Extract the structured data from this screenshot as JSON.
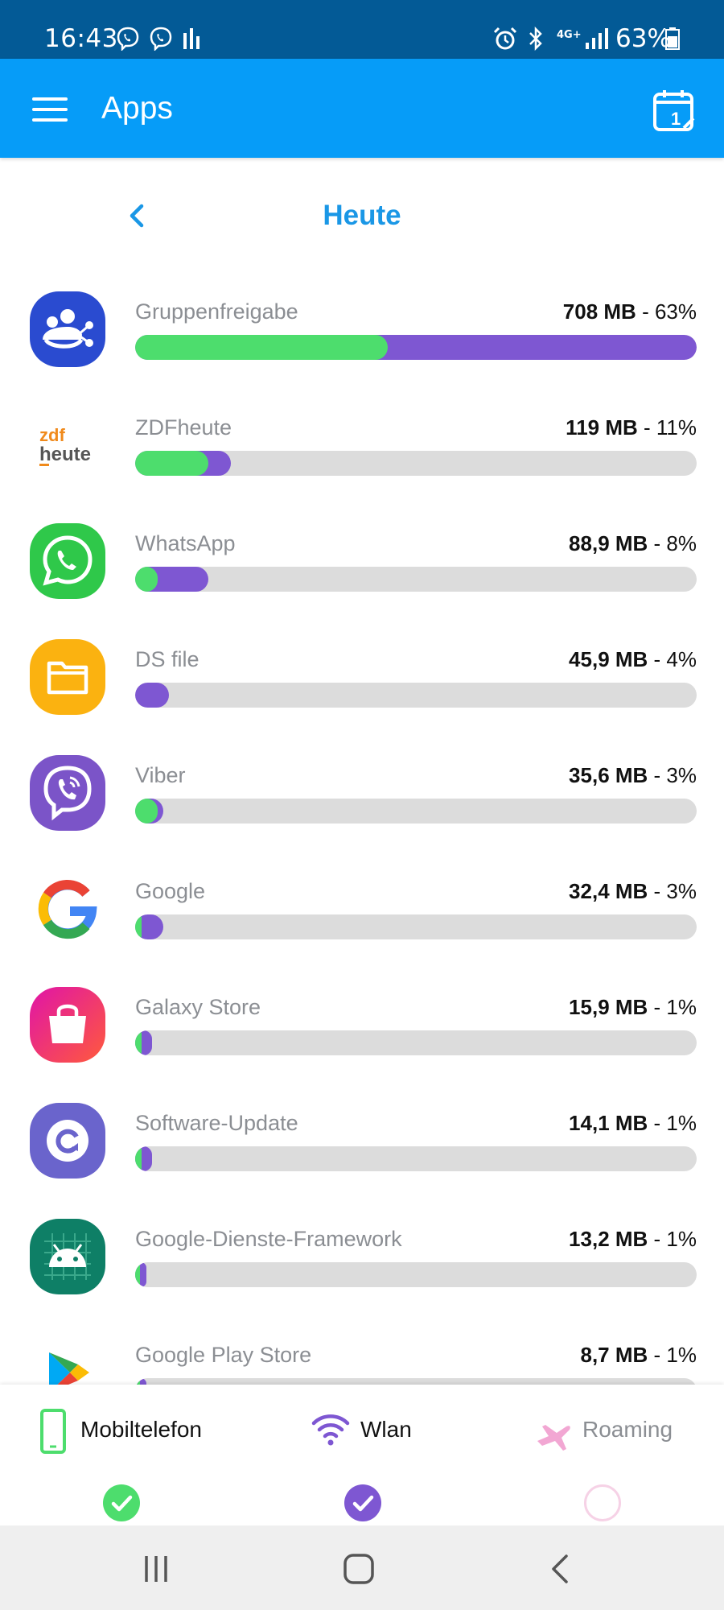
{
  "status_bar": {
    "time": "16:43",
    "battery": "63%",
    "network": "4G+"
  },
  "app_bar": {
    "title": "Apps",
    "calendar_day": "1"
  },
  "period": {
    "title": "Heute"
  },
  "apps": [
    {
      "name": "Gruppenfreigabe",
      "size": "708 MB",
      "percent": "63%",
      "fill_total": 1.0,
      "fill_mobile": 0.45
    },
    {
      "name": "ZDFheute",
      "size": "119 MB",
      "percent": "11%",
      "fill_total": 0.17,
      "fill_mobile": 0.13
    },
    {
      "name": "WhatsApp",
      "size": "88,9 MB",
      "percent": "8%",
      "fill_total": 0.13,
      "fill_mobile": 0.04
    },
    {
      "name": "DS file",
      "size": "45,9 MB",
      "percent": "4%",
      "fill_total": 0.06,
      "fill_mobile": 0.0
    },
    {
      "name": "Viber",
      "size": "35,6 MB",
      "percent": "3%",
      "fill_total": 0.05,
      "fill_mobile": 0.04
    },
    {
      "name": "Google",
      "size": "32,4 MB",
      "percent": "3%",
      "fill_total": 0.05,
      "fill_mobile": 0.012
    },
    {
      "name": "Galaxy Store",
      "size": "15,9 MB",
      "percent": "1%",
      "fill_total": 0.03,
      "fill_mobile": 0.012
    },
    {
      "name": "Software-Update",
      "size": "14,1 MB",
      "percent": "1%",
      "fill_total": 0.03,
      "fill_mobile": 0.012
    },
    {
      "name": "Google-Dienste-Framework",
      "size": "13,2 MB",
      "percent": "1%",
      "fill_total": 0.02,
      "fill_mobile": 0.008
    },
    {
      "name": "Google Play Store",
      "size": "8,7 MB",
      "percent": "1%",
      "fill_total": 0.02,
      "fill_mobile": 0.008
    }
  ],
  "zdf_logo": {
    "line1": "zdf",
    "line2": "heute"
  },
  "filters": [
    {
      "label": "Mobiltelefon",
      "checked": true,
      "color": "#4ddd6d"
    },
    {
      "label": "Wlan",
      "checked": true,
      "color": "#7e57d2"
    },
    {
      "label": "Roaming",
      "checked": false,
      "color": "#f2a7d3"
    }
  ],
  "colors": {
    "status_bar": "#035a96",
    "app_bar": "#069cf8",
    "accent_title": "#1a97e6",
    "wifi_bar": "#7e57d2",
    "mobile_bar": "#4ddd6d",
    "track": "#dcdcdc"
  },
  "icons": {
    "menu": "hamburger-menu-icon",
    "calendar": "calendar-icon",
    "back": "chevron-left-icon",
    "mobile": "smartphone-icon",
    "wlan": "wifi-icon",
    "roaming": "airplane-icon"
  }
}
